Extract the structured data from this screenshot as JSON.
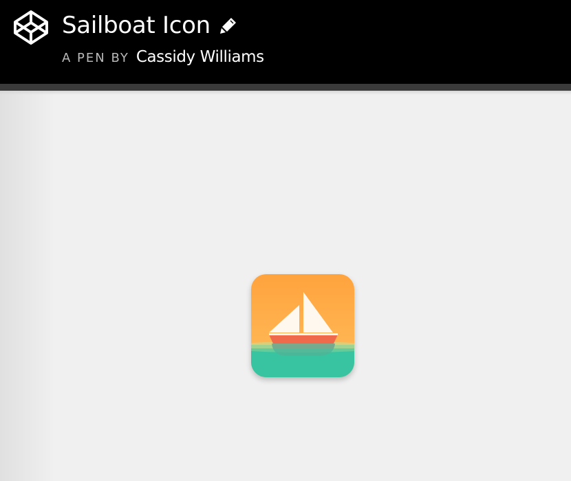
{
  "header": {
    "pen_title": "Sailboat Icon",
    "byline_prefix": "A PEN BY",
    "author": "Cassidy Williams",
    "logo_icon": "codepen-logo-icon",
    "edit_icon": "pencil-icon"
  },
  "colors": {
    "header_bg": "#000000",
    "page_bg": "#f0f0f0",
    "sky_top": "#ffa33d",
    "sky_bottom": "#ffbe5c",
    "sail": "#fff8ee",
    "hull": "#ee6a4b",
    "water": "#38c4a0"
  },
  "preview": {
    "icon": "sailboat-icon"
  }
}
